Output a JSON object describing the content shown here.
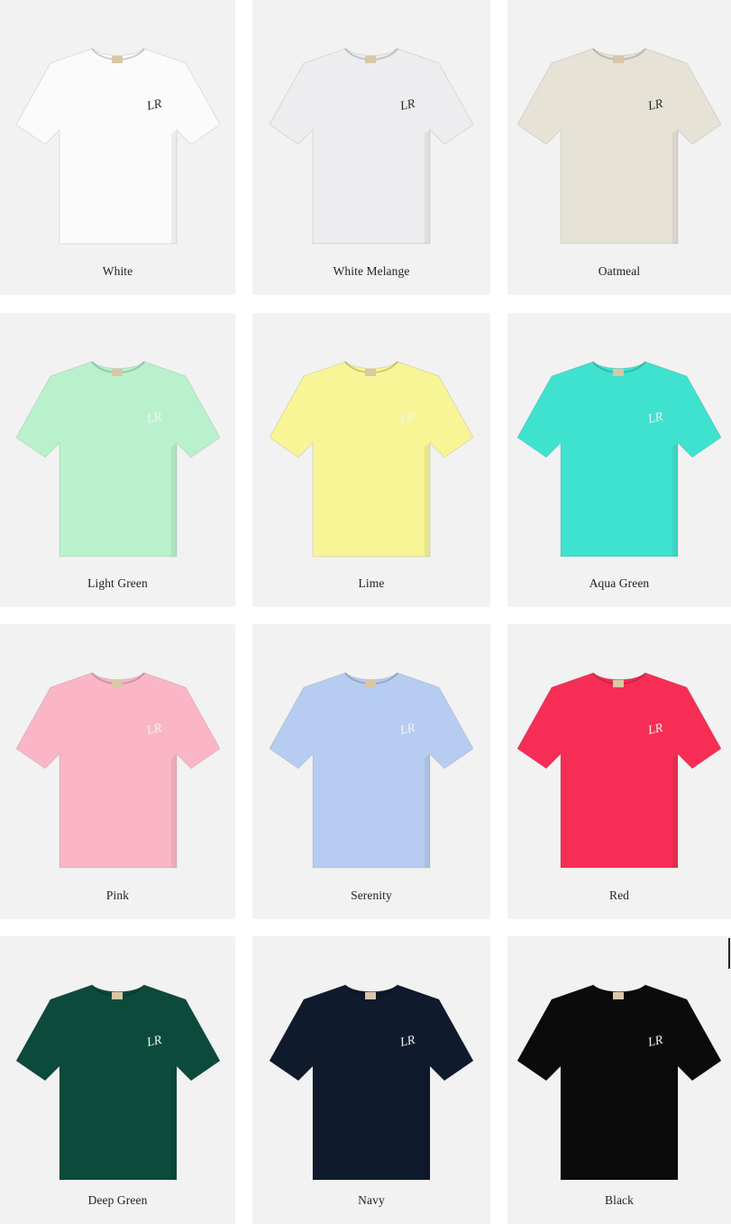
{
  "products": [
    {
      "name": "White",
      "color": "#fbfbfb",
      "logo_color": "#2a2a2a"
    },
    {
      "name": "White Melange",
      "color": "#ededf0",
      "logo_color": "#2a2a2a"
    },
    {
      "name": "Oatmeal",
      "color": "#e6e2d6",
      "logo_color": "#2a2a2a"
    },
    {
      "name": "Light Green",
      "color": "#b9f1cd",
      "logo_color": "#f4f4f4"
    },
    {
      "name": "Lime",
      "color": "#f8f596",
      "logo_color": "#f4f4f4"
    },
    {
      "name": "Aqua Green",
      "color": "#3fe2cf",
      "logo_color": "#f4f4f4"
    },
    {
      "name": "Pink",
      "color": "#fab6c6",
      "logo_color": "#f4f4f4"
    },
    {
      "name": "Serenity",
      "color": "#b6cdf1",
      "logo_color": "#f4f4f4"
    },
    {
      "name": "Red",
      "color": "#f62e55",
      "logo_color": "#f4f4f4"
    },
    {
      "name": "Deep Green",
      "color": "#0c4a3c",
      "logo_color": "#f4f4f4"
    },
    {
      "name": "Navy",
      "color": "#0f1a2c",
      "logo_color": "#f4f4f4"
    },
    {
      "name": "Black",
      "color": "#0b0b0b",
      "logo_color": "#f4f4f4"
    }
  ],
  "logo_text": "LR"
}
